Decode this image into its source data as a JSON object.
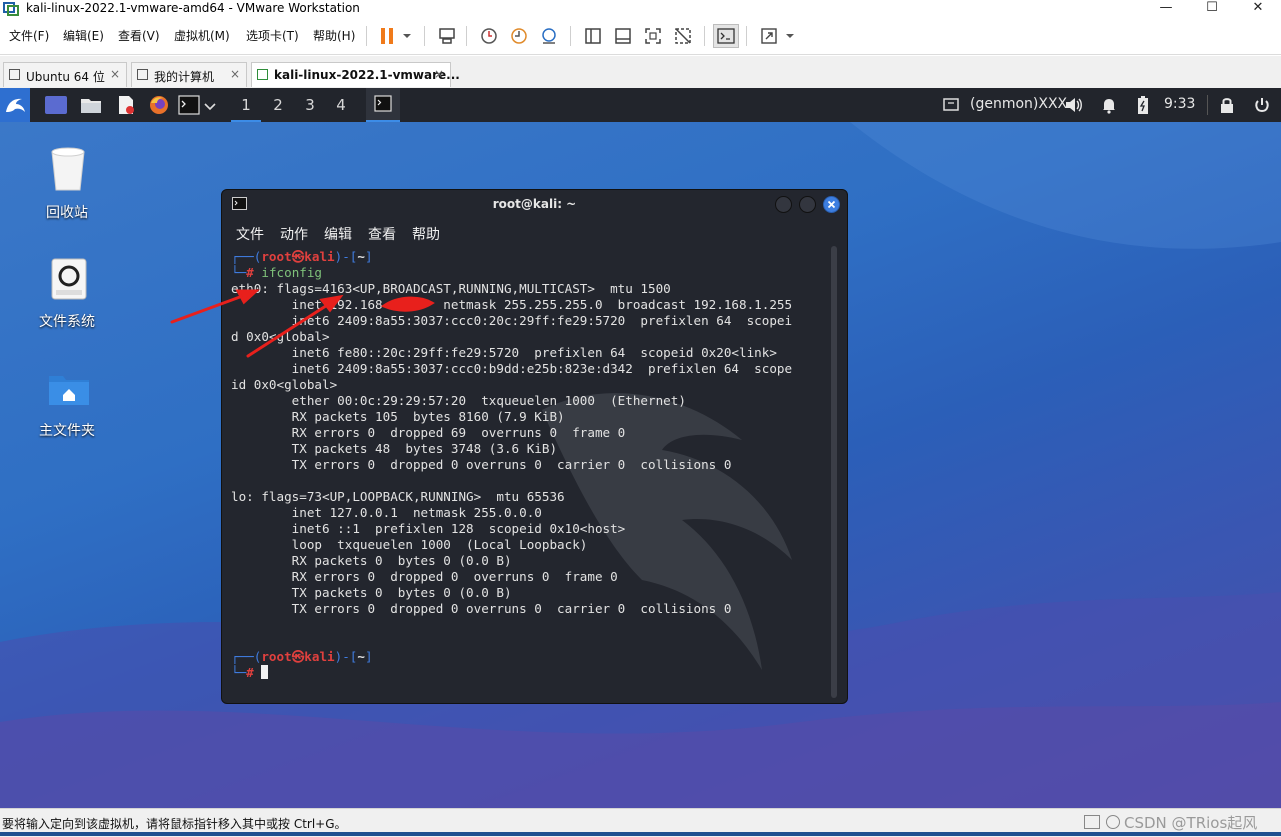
{
  "window": {
    "title": "kali-linux-2022.1-vmware-amd64 - VMware Workstation"
  },
  "menubar": {
    "items": [
      "文件(F)",
      "编辑(E)",
      "查看(V)",
      "虚拟机(M)",
      "选项卡(T)",
      "帮助(H)"
    ]
  },
  "tabs": [
    {
      "label": "Ubuntu 64 位",
      "close": "×"
    },
    {
      "label": "我的计算机",
      "close": "×"
    },
    {
      "label": "kali-linux-2022.1-vmware...",
      "close": "×"
    }
  ],
  "panel": {
    "workspaces": [
      "1",
      "2",
      "3",
      "4"
    ],
    "genmon": "(genmon)XXX",
    "clock": "9:33"
  },
  "desktop": {
    "icons": [
      {
        "label": "回收站"
      },
      {
        "label": "文件系统"
      },
      {
        "label": "主文件夹"
      }
    ]
  },
  "terminal": {
    "title": "root@kali: ~",
    "menu": [
      "文件",
      "动作",
      "编辑",
      "查看",
      "帮助"
    ],
    "prompt_user": "root",
    "prompt_at": "㉿",
    "prompt_host": "kali",
    "prompt_dir": "~",
    "command": "ifconfig",
    "output": [
      "eth0: flags=4163<UP,BROADCAST,RUNNING,MULTICAST>  mtu 1500",
      "        inet 192.168        netmask 255.255.255.0  broadcast 192.168.1.255",
      "        inet6 2409:8a55:3037:ccc0:20c:29ff:fe29:5720  prefixlen 64  scopei",
      "d 0x0<global>",
      "        inet6 fe80::20c:29ff:fe29:5720  prefixlen 64  scopeid 0x20<link>",
      "        inet6 2409:8a55:3037:ccc0:b9dd:e25b:823e:d342  prefixlen 64  scope",
      "id 0x0<global>",
      "        ether 00:0c:29:29:57:20  txqueuelen 1000  (Ethernet)",
      "        RX packets 105  bytes 8160 (7.9 KiB)",
      "        RX errors 0  dropped 69  overruns 0  frame 0",
      "        TX packets 48  bytes 3748 (3.6 KiB)",
      "        TX errors 0  dropped 0 overruns 0  carrier 0  collisions 0",
      "",
      "lo: flags=73<UP,LOOPBACK,RUNNING>  mtu 65536",
      "        inet 127.0.0.1  netmask 255.0.0.0",
      "        inet6 ::1  prefixlen 128  scopeid 0x10<host>",
      "        loop  txqueuelen 1000  (Local Loopback)",
      "        RX packets 0  bytes 0 (0.0 B)",
      "        RX errors 0  dropped 0  overruns 0  frame 0",
      "        TX packets 0  bytes 0 (0.0 B)",
      "        TX errors 0  dropped 0 overruns 0  carrier 0  collisions 0"
    ]
  },
  "statusbar": {
    "message": "要将输入定向到该虚拟机，请将鼠标指针移入其中或按 Ctrl+G。",
    "watermark": "CSDN @TRios起风"
  },
  "colors": {
    "panel": "#22252c",
    "terminal_bg": "#23262e",
    "prompt_blue": "#3f7ce0",
    "prompt_red": "#e0403e",
    "annotation_red": "#e8201c"
  }
}
